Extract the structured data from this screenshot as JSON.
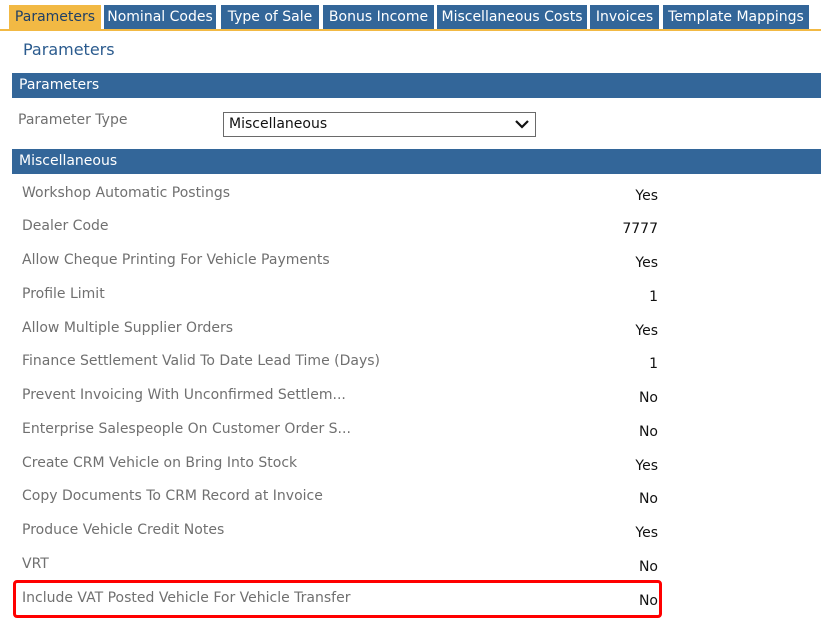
{
  "tabs": [
    {
      "label": "Parameters",
      "active": true
    },
    {
      "label": "Nominal Codes",
      "active": false
    },
    {
      "label": "Type of Sale",
      "active": false
    },
    {
      "label": "Bonus Income",
      "active": false
    },
    {
      "label": "Miscellaneous Costs",
      "active": false
    },
    {
      "label": "Invoices",
      "active": false
    },
    {
      "label": "Template Mappings",
      "active": false
    }
  ],
  "page_title": "Parameters",
  "parameters_section": {
    "header": "Parameters",
    "parameter_type_label": "Parameter Type",
    "parameter_type_value": "Miscellaneous"
  },
  "misc_section": {
    "header": "Miscellaneous",
    "rows": [
      {
        "label": "Workshop Automatic Postings",
        "value": "Yes"
      },
      {
        "label": "Dealer Code",
        "value": "7777"
      },
      {
        "label": "Allow Cheque Printing For Vehicle Payments",
        "value": "Yes"
      },
      {
        "label": "Profile Limit",
        "value": "1"
      },
      {
        "label": "Allow Multiple Supplier Orders",
        "value": "Yes"
      },
      {
        "label": "Finance Settlement Valid To Date Lead Time (Days)",
        "value": "1"
      },
      {
        "label": "Prevent Invoicing With Unconfirmed Settlem...",
        "value": "No"
      },
      {
        "label": "Enterprise Salespeople On Customer Order S...",
        "value": "No"
      },
      {
        "label": "Create CRM Vehicle on Bring Into Stock",
        "value": "Yes"
      },
      {
        "label": "Copy Documents To CRM Record at Invoice",
        "value": "No"
      },
      {
        "label": "Produce Vehicle Credit Notes",
        "value": "Yes"
      },
      {
        "label": "VRT",
        "value": "No"
      },
      {
        "label": "Include VAT Posted Vehicle For Vehicle Transfer",
        "value": "No",
        "highlighted": true
      }
    ]
  },
  "colors": {
    "tab_bg": "#336699",
    "tab_active_bg": "#f2b944",
    "band_bg": "#336699",
    "highlight_border": "#ff0000"
  }
}
